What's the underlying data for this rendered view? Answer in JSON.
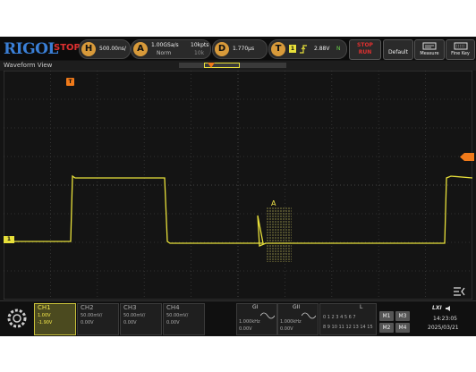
{
  "topbar": {
    "logo": "RIGOL",
    "run_state": "STOP",
    "horizontal": {
      "letter": "H",
      "timebase": "500.00ns/"
    },
    "acquire": {
      "letter": "A",
      "rate": "1.00GSa/s",
      "mode": "Norm",
      "points": "10kpts",
      "depth": "10k"
    },
    "delay": {
      "letter": "D",
      "value": "1.770µs"
    },
    "trigger": {
      "letter": "T",
      "source": "1",
      "level": "2.88V",
      "sweep": "N"
    },
    "run_stop_button": {
      "line1": "STOP",
      "line2": "RUN"
    },
    "default_button": "Default",
    "measure_button": "Measure",
    "fine_button": "Fine Key"
  },
  "waveform_view": {
    "title": "Waveform View",
    "trigger_marker": "T",
    "cursor_label": "A",
    "channel_marker": "1"
  },
  "channels": [
    {
      "name": "CH1",
      "scale": "1.00V",
      "offset": "-1.90V",
      "active": true
    },
    {
      "name": "CH2",
      "scale": "50.00mV/",
      "offset": "0.00V",
      "active": false
    },
    {
      "name": "CH3",
      "scale": "50.00mV/",
      "offset": "0.00V",
      "active": false
    },
    {
      "name": "CH4",
      "scale": "50.00mV/",
      "offset": "0.00V",
      "active": false
    }
  ],
  "generators": [
    {
      "name": "GI",
      "freq": "1.000kHz",
      "amp": "0.00V"
    },
    {
      "name": "GII",
      "freq": "1.000kHz",
      "amp": "0.00V"
    }
  ],
  "logic": {
    "name": "L",
    "row1": "0 1 2 3   4 5 6 7",
    "row2": "8 9 10 11  12 13 14 15"
  },
  "math": [
    "M1",
    "M3",
    "M2",
    "M4"
  ],
  "status": {
    "time": "14:23:05",
    "date": "2025/03/21",
    "lxi": "LXI"
  },
  "colors": {
    "ch1": "#e8e03a",
    "trigger": "#f07a1a",
    "accent": "#3a7fd6"
  }
}
